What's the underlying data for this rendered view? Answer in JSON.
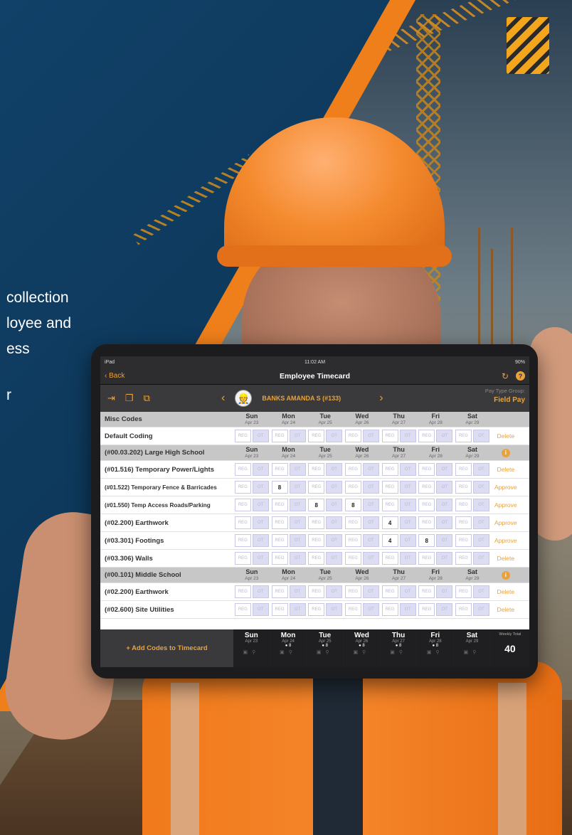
{
  "marketing_copy": [
    "collection",
    "loyee and",
    "ess",
    "r"
  ],
  "status": {
    "left": "iPad",
    "time": "11:02 AM",
    "battery": "90%"
  },
  "nav": {
    "back": "Back",
    "title": "Employee Timecard"
  },
  "employee": {
    "name": "BANKS AMANDA S (#133)",
    "pay_type_group_label": "Pay Type Group:",
    "pay_type_group_value": "Field Pay"
  },
  "days": [
    {
      "name": "Sun",
      "date": "Apr 23"
    },
    {
      "name": "Mon",
      "date": "Apr 24"
    },
    {
      "name": "Tue",
      "date": "Apr 25"
    },
    {
      "name": "Wed",
      "date": "Apr 26"
    },
    {
      "name": "Thu",
      "date": "Apr 27"
    },
    {
      "name": "Fri",
      "date": "Apr 28"
    },
    {
      "name": "Sat",
      "date": "Apr 29"
    }
  ],
  "cell_labels": {
    "reg": "REG",
    "ot": "OT"
  },
  "rows": [
    {
      "type": "header",
      "label": "Misc Codes"
    },
    {
      "type": "code",
      "label": "Default Coding",
      "action": "Delete",
      "values": {}
    },
    {
      "type": "header",
      "label": "(#00.03.202) Large High School",
      "info": "i"
    },
    {
      "type": "code",
      "label": "(#01.516) Temporary Power/Lights",
      "action": "Delete",
      "values": {}
    },
    {
      "type": "code",
      "label": "(#01.522) Temporary Fence & Barricades",
      "action": "Approve",
      "small": true,
      "values": {
        "1": "8"
      }
    },
    {
      "type": "code",
      "label": "(#01.550) Temp Access Roads/Parking",
      "action": "Approve",
      "small": true,
      "values": {
        "2": "8",
        "3": "8"
      }
    },
    {
      "type": "code",
      "label": "(#02.200) Earthwork",
      "action": "Approve",
      "values": {
        "4": "4"
      }
    },
    {
      "type": "code",
      "label": "(#03.301) Footings",
      "action": "Approve",
      "values": {
        "4": "4",
        "5": "8"
      }
    },
    {
      "type": "code",
      "label": "(#03.306) Walls",
      "action": "Delete",
      "values": {}
    },
    {
      "type": "header",
      "label": "(#00.101) Middle School",
      "info": "i"
    },
    {
      "type": "code",
      "label": "(#02.200) Earthwork",
      "action": "Delete",
      "values": {}
    },
    {
      "type": "code",
      "label": "(#02.600) Site Utilities",
      "action": "Delete",
      "values": {}
    }
  ],
  "footer": {
    "add_codes": "+ Add Codes to Timecard",
    "day_dots": [
      "",
      "● 8",
      "● 8",
      "● 8",
      "● 8",
      "● 8",
      ""
    ],
    "weekly_total_label": "Weekly Total",
    "weekly_total_value": "40"
  },
  "colors": {
    "accent": "#e9a23b",
    "navy": "#0f3a5f",
    "orange": "#ef7f1a"
  }
}
